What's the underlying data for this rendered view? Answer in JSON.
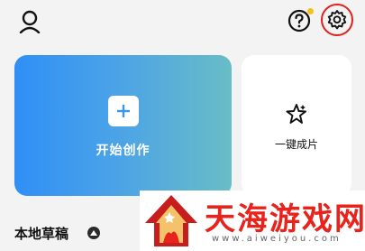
{
  "header": {
    "icons": [
      "user-icon",
      "help-icon",
      "settings-icon"
    ]
  },
  "cards": {
    "create": {
      "label": "开始创作",
      "icon": "plus-icon",
      "gradient": [
        "#2f8ff6",
        "#68bdc6"
      ]
    },
    "one_click": {
      "label": "一键成片",
      "icon": "sparkle-star-icon"
    }
  },
  "drafts": {
    "title": "本地草稿",
    "toggle_icon": "caret-up-icon"
  },
  "watermark": {
    "title": "天海游戏网",
    "url": "www.aiweiyou.com",
    "color": "#e8231c"
  },
  "colors": {
    "highlight_ring": "#e3201b",
    "notification_dot": "#f5c21b"
  }
}
